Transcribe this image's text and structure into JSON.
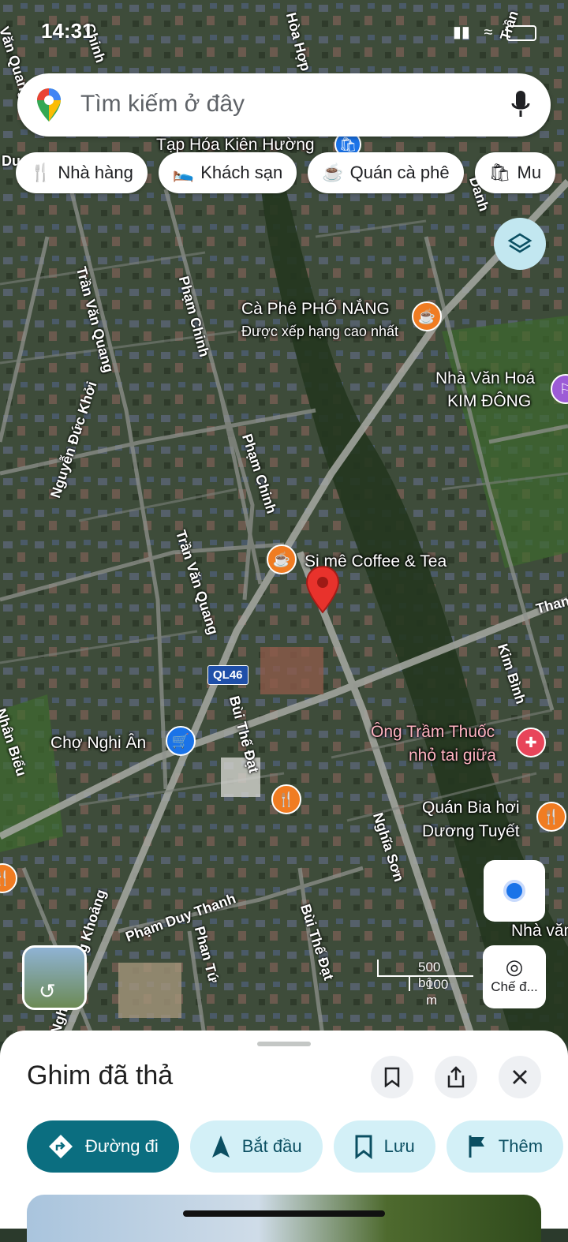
{
  "status_bar": {
    "time": "14:31"
  },
  "search": {
    "placeholder": "Tìm kiếm ở đây"
  },
  "chips": [
    {
      "label": "Nhà hàng",
      "icon": "fork-knife-icon"
    },
    {
      "label": "Khách sạn",
      "icon": "bed-icon"
    },
    {
      "label": "Quán cà phê",
      "icon": "coffee-icon"
    },
    {
      "label": "Mu",
      "icon": "shopping-bag-icon"
    }
  ],
  "map": {
    "places": {
      "tap_hoa": "Tạp Hóa Kiên Hường",
      "cafe_pho_nang": "Cà Phê PHỐ NẮNG",
      "cafe_pho_nang_sub": "Được xếp hạng cao nhất",
      "nha_van_hoa_1": "Nhà Văn Hoá",
      "nha_van_hoa_2": "KIM ĐÔNG",
      "si_me": "Si mê Coffee & Tea",
      "cho_nghi_an": "Chợ Nghi Ân",
      "ong_tram_1": "Ông Trầm Thuốc",
      "ong_tram_2": "nhỏ tai giữa",
      "quan_bia_1": "Quán Bia hơi",
      "quan_bia_2": "Dương Tuyết",
      "nha_va": "Nhà văn"
    },
    "streets": {
      "tran_van_quang_1": "Trần Văn Quang",
      "tran_van_quang_2": "Trần Văn Quang",
      "pham_chinh_1": "Phạm Chinh",
      "pham_chinh_2": "Phạm Chinh",
      "nguyen_duc_khoi": "Nguyễn Đức Khởi",
      "bui_the_dat_1": "Bùi Thế Đạt",
      "bui_the_dat_2": "Bùi Thế Đạt",
      "nghia_son": "Nghĩa Sơn",
      "kim_binh": "Kim Bình",
      "pham_duy_thanh": "Phạm Duy Thanh",
      "phan_tu": "Phan Tứ",
      "xieng_khoang": "Nghi... - Xiêng Khoảng",
      "hoa_hop": "Hòa Hợp",
      "thanh": "Thanh",
      "nhan_bieu": "Nhân Biểu",
      "tran_top": "Trần",
      "van_quang_top": "Văn Quang",
      "chinh_top": "Chinh",
      "du": "Du",
      "danh": "Danh"
    },
    "route_badge": "QL46",
    "scale": {
      "ft": "500 bộ",
      "m": "100 m"
    }
  },
  "lens": {
    "label": "Chế đ..."
  },
  "sheet": {
    "title": "Ghim đã thả",
    "actions": [
      {
        "label": "Đường đi",
        "icon": "directions-icon"
      },
      {
        "label": "Bắt đầu",
        "icon": "navigation-arrow-icon"
      },
      {
        "label": "Lưu",
        "icon": "bookmark-icon"
      },
      {
        "label": "Thêm",
        "icon": "flag-icon"
      }
    ]
  }
}
